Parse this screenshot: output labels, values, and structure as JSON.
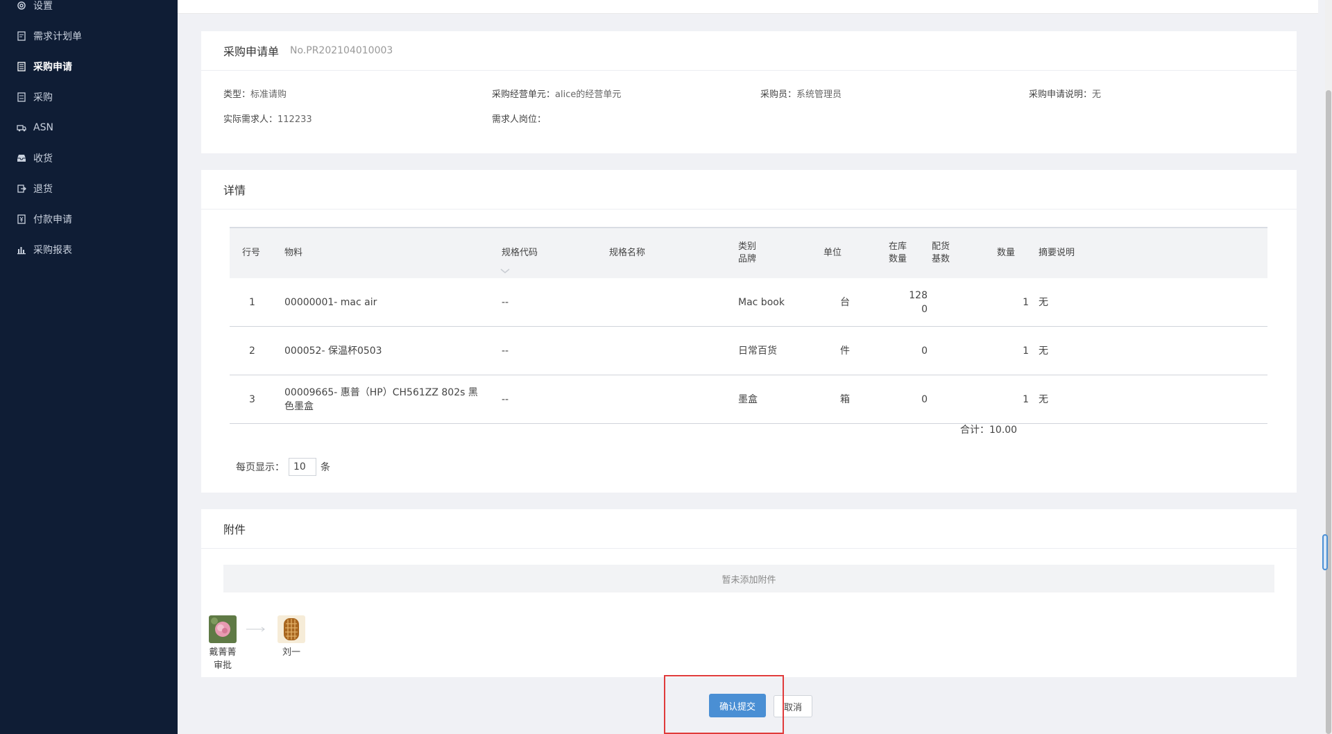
{
  "sidebar": {
    "items": [
      {
        "label": "设置",
        "icon": "gear-icon"
      },
      {
        "label": "需求计划单",
        "icon": "document-icon"
      },
      {
        "label": "采购申请",
        "icon": "clipboard-icon",
        "active": true
      },
      {
        "label": "采购",
        "icon": "list-icon"
      },
      {
        "label": "ASN",
        "icon": "truck-icon"
      },
      {
        "label": "收货",
        "icon": "inbox-icon"
      },
      {
        "label": "退货",
        "icon": "return-icon"
      },
      {
        "label": "付款申请",
        "icon": "payment-icon"
      },
      {
        "label": "采购报表",
        "icon": "bar-chart-icon"
      }
    ]
  },
  "header_panel": {
    "title": "采购申请单",
    "number": "No.PR202104010003",
    "fields": {
      "type_label": "类型：",
      "type_value": "标准请购",
      "unit_label": "采购经营单元：",
      "unit_value": "alice的经营单元",
      "buyer_label": "采购员：",
      "buyer_value": "系统管理员",
      "desc_label": "采购申请说明：",
      "desc_value": "无",
      "requester_label": "实际需求人：",
      "requester_value": "112233",
      "position_label": "需求人岗位：",
      "position_value": ""
    }
  },
  "details_panel": {
    "title": "详情",
    "columns": {
      "line": "行号",
      "material": "物料",
      "spec_code": "规格代码",
      "spec_name": "规格名称",
      "category_1": "类别",
      "category_2": "品牌",
      "unit": "单位",
      "stock_1": "在库",
      "stock_2": "数量",
      "ratio_1": "配货",
      "ratio_2": "基数",
      "qty": "数量",
      "remark": "摘要说明"
    },
    "rows": [
      {
        "line": "1",
        "material": "00000001- mac air",
        "spec_code": "--",
        "spec_name": "",
        "category": "Mac book",
        "unit": "台",
        "stock_1": "128",
        "stock_2": "0",
        "ratio": "",
        "qty": "1",
        "remark": "无"
      },
      {
        "line": "2",
        "material": "000052- 保温杯0503",
        "spec_code": "--",
        "spec_name": "",
        "category": "日常百货",
        "unit": "件",
        "stock_1": "0",
        "stock_2": "",
        "ratio": "",
        "qty": "1",
        "remark": "无"
      },
      {
        "line": "3",
        "material": "00009665- 惠普（HP）CH561ZZ 802s 黑色墨盒",
        "spec_code": "--",
        "spec_name": "",
        "category": "墨盒",
        "unit": "箱",
        "stock_1": "0",
        "stock_2": "",
        "ratio": "",
        "qty": "1",
        "remark": "无"
      }
    ],
    "total_label": "合计：",
    "total_value": "10.00",
    "pager_label": "每页显示：",
    "pager_value": "10",
    "pager_unit": "条"
  },
  "attachments_panel": {
    "title": "附件",
    "empty_text": "暂未添加附件"
  },
  "approval_flow": [
    {
      "name": "戴菁菁",
      "role": "审批",
      "avatar": "flower-avatar"
    },
    {
      "name": "刘一",
      "role": "",
      "avatar": "waffle-avatar"
    }
  ],
  "actions": {
    "confirm_label": "确认提交",
    "cancel_label": "取消"
  },
  "colors": {
    "sidebar_bg": "#0f1d35",
    "primary_button": "#4a8fd4",
    "highlight": "#e03a3a"
  }
}
